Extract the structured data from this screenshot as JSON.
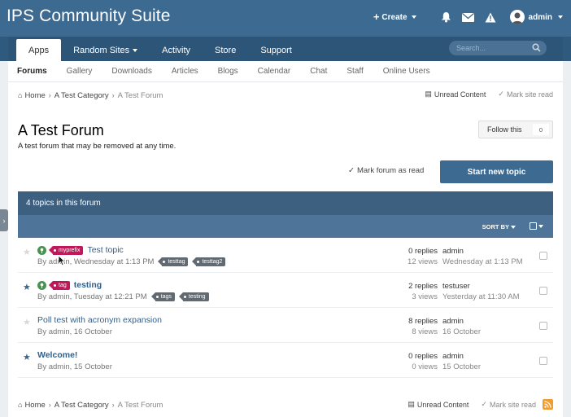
{
  "header": {
    "site_title": "IPS Community Suite",
    "create_label": "Create",
    "user_name": "admin",
    "icons": [
      "bell-icon",
      "envelope-icon",
      "warning-icon"
    ]
  },
  "nav": {
    "tabs": [
      {
        "label": "Apps",
        "active": true
      },
      {
        "label": "Random Sites",
        "dropdown": true
      },
      {
        "label": "Activity"
      },
      {
        "label": "Store"
      },
      {
        "label": "Support"
      }
    ],
    "search_placeholder": "Search..."
  },
  "subnav": [
    "Forums",
    "Gallery",
    "Downloads",
    "Articles",
    "Blogs",
    "Calendar",
    "Chat",
    "Staff",
    "Online Users"
  ],
  "breadcrumb": {
    "home": "Home",
    "category": "A Test Category",
    "current": "A Test Forum",
    "unread": "Unread Content",
    "mark_read": "Mark site read"
  },
  "forum": {
    "title": "A Test Forum",
    "description": "A test forum that may be removed at any time.",
    "follow_label": "Follow this",
    "follow_count": "0",
    "mark_forum_read": "Mark forum as read",
    "start_topic": "Start new topic",
    "topic_count_label": "4 topics in this forum",
    "sort_by": "SORT BY"
  },
  "topics": [
    {
      "starred": false,
      "pinned": true,
      "prefix": "myprefix",
      "title": "Test topic",
      "bold": false,
      "meta": "By admin, Wednesday at 1:13 PM",
      "tags": [
        "testtag",
        "testtag2"
      ],
      "replies": "0 replies",
      "views": "12 views",
      "last_user": "admin",
      "last_date": "Wednesday at 1:13 PM"
    },
    {
      "starred": true,
      "pinned": true,
      "prefix": "tag",
      "title": "testing",
      "bold": true,
      "meta": "By admin, Tuesday at 12:21 PM",
      "tags": [
        "tags",
        "testing"
      ],
      "replies": "2 replies",
      "views": "3 views",
      "last_user": "testuser",
      "last_date": "Yesterday at 11:30 AM"
    },
    {
      "starred": false,
      "pinned": false,
      "prefix": null,
      "title": "Poll test with acronym expansion",
      "bold": false,
      "meta": "By admin, 16 October",
      "tags": [],
      "replies": "8 replies",
      "views": "8 views",
      "last_user": "admin",
      "last_date": "16 October"
    },
    {
      "starred": true,
      "pinned": false,
      "prefix": null,
      "title": "Welcome!",
      "bold": true,
      "meta": "By admin, 15 October",
      "tags": [],
      "replies": "0 replies",
      "views": "0 views",
      "last_user": "admin",
      "last_date": "15 October"
    }
  ],
  "colors": {
    "brand": "#3d6a91",
    "prefix": "#c1175b",
    "tag": "#616a72",
    "link": "#2f5f8d"
  }
}
